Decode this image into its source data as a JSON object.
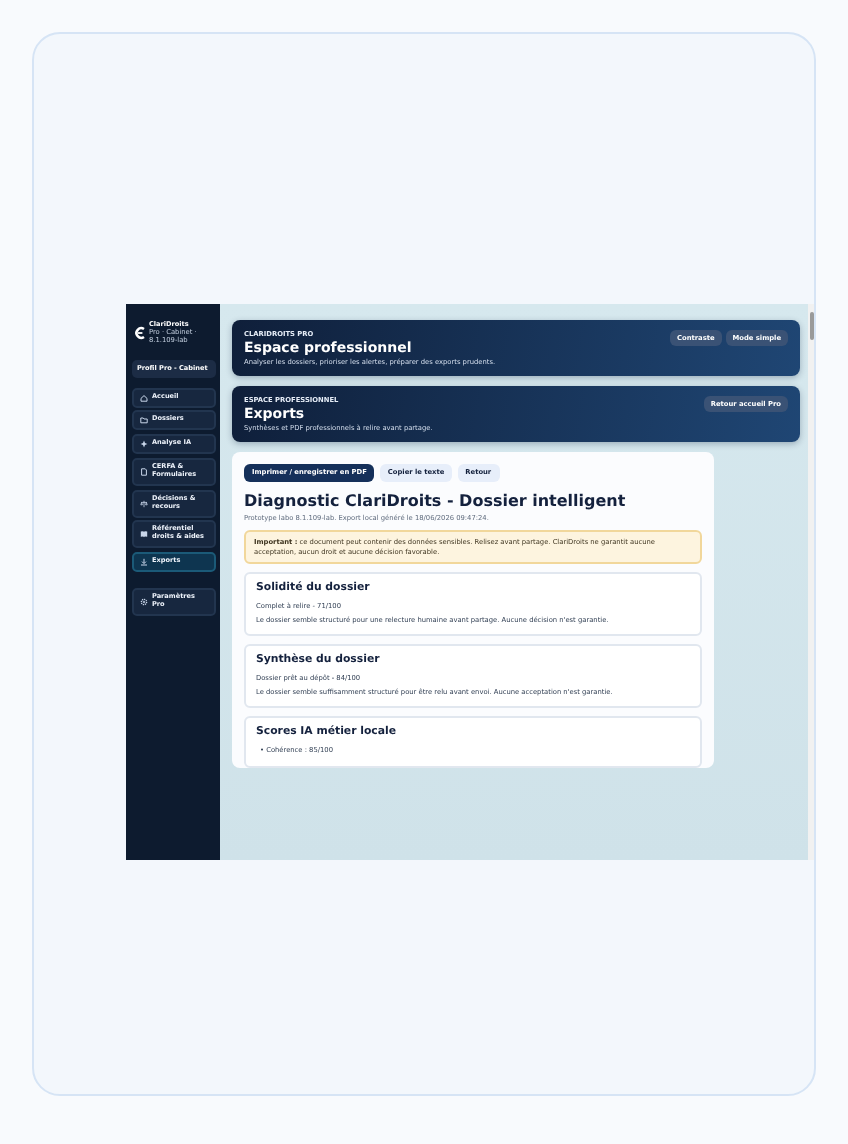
{
  "sidebar": {
    "brand": "ClariDroits",
    "subtitle": "Pro · Cabinet · 8.1.109-lab",
    "profile": "Profil Pro - Cabinet",
    "items": [
      {
        "label": "Accueil",
        "selected": false
      },
      {
        "label": "Dossiers",
        "selected": false
      },
      {
        "label": "Analyse IA",
        "selected": false
      },
      {
        "label": "CERFA & Formulaires",
        "selected": false
      },
      {
        "label": "Décisions & recours",
        "selected": false
      },
      {
        "label": "Référentiel droits & aides",
        "selected": false
      },
      {
        "label": "Exports",
        "selected": true
      },
      {
        "label": "Paramètres Pro",
        "selected": false
      }
    ]
  },
  "heroes": [
    {
      "kicker": "CLARIDROITS PRO",
      "title": "Espace professionnel",
      "subtitle": "Analyser les dossiers, prioriser les alertes, préparer des exports prudents.",
      "buttons": [
        "Contraste",
        "Mode simple"
      ]
    },
    {
      "kicker": "ESPACE PROFESSIONNEL",
      "title": "Exports",
      "subtitle": "Synthèses et PDF professionnels à relire avant partage.",
      "buttons": [
        "Retour accueil Pro"
      ]
    }
  ],
  "report": {
    "actions": [
      {
        "label": "Imprimer / enregistrer en PDF",
        "primary": true
      },
      {
        "label": "Copier le texte",
        "primary": false
      },
      {
        "label": "Retour",
        "primary": false
      }
    ],
    "title": "Diagnostic ClariDroits - Dossier intelligent",
    "meta": "Prototype labo 8.1.109-lab. Export local généré le 18/06/2026 09:47:24.",
    "notice": "**Important :** ce document peut contenir des données sensibles. Relisez avant partage. ClariDroits ne garantit aucune acceptation, aucun droit et aucune décision favorable.",
    "sections": [
      {
        "kind": "summary",
        "title": "Solidité du dossier",
        "score": "Complet à relire - 71/100",
        "text": "Le dossier semble structuré pour une relecture humaine avant partage. Aucune décision n'est garantie."
      },
      {
        "kind": "summary",
        "title": "Synthèse du dossier",
        "score": "Dossier prêt au dépôt - 84/100",
        "text": "Le dossier semble suffisamment structuré pour être relu avant envoi. Aucune acceptation n'est garantie."
      },
      {
        "kind": "list",
        "title": "Scores IA métier locale",
        "bullets": [
          "• Cohérence : 85/100"
        ]
      }
    ]
  }
}
